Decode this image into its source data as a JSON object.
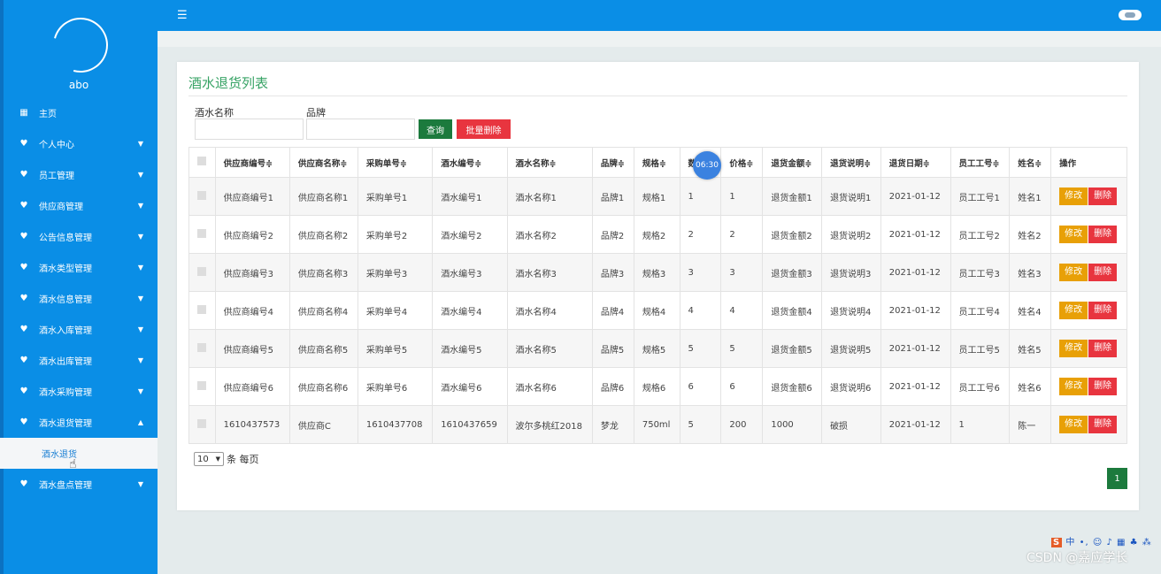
{
  "sidebar": {
    "username": "abo",
    "items": [
      {
        "label": "主页",
        "icon": "dashboard-icon",
        "expandable": false
      },
      {
        "label": "个人中心",
        "icon": "user-icon",
        "expandable": true
      },
      {
        "label": "员工管理",
        "icon": "user-icon",
        "expandable": true
      },
      {
        "label": "供应商管理",
        "icon": "user-icon",
        "expandable": true
      },
      {
        "label": "公告信息管理",
        "icon": "user-icon",
        "expandable": true
      },
      {
        "label": "酒水类型管理",
        "icon": "user-icon",
        "expandable": true
      },
      {
        "label": "酒水信息管理",
        "icon": "user-icon",
        "expandable": true
      },
      {
        "label": "酒水入库管理",
        "icon": "user-icon",
        "expandable": true
      },
      {
        "label": "酒水出库管理",
        "icon": "user-icon",
        "expandable": true
      },
      {
        "label": "酒水采购管理",
        "icon": "user-icon",
        "expandable": true
      },
      {
        "label": "酒水退货管理",
        "icon": "user-icon",
        "expandable": true,
        "expanded": true
      }
    ],
    "subitem": "酒水退货",
    "last_item": {
      "label": "酒水盘点管理",
      "icon": "user-icon",
      "expandable": true
    }
  },
  "page": {
    "title": "酒水退货列表",
    "filter_name_label": "酒水名称",
    "filter_brand_label": "品牌",
    "query_label": "查询",
    "batch_delete_label": "批量删除"
  },
  "table": {
    "headers": [
      "供应商编号≑",
      "供应商名称≑",
      "采购单号≑",
      "酒水编号≑",
      "酒水名称≑",
      "品牌≑",
      "规格≑",
      "数量≑",
      "价格≑",
      "退货金额≑",
      "退货说明≑",
      "退货日期≑",
      "员工工号≑",
      "姓名≑",
      "操作"
    ],
    "rows": [
      [
        "供应商编号1",
        "供应商名称1",
        "采购单号1",
        "酒水编号1",
        "酒水名称1",
        "品牌1",
        "规格1",
        "1",
        "1",
        "退货金额1",
        "退货说明1",
        "2021-01-12",
        "员工工号1",
        "姓名1"
      ],
      [
        "供应商编号2",
        "供应商名称2",
        "采购单号2",
        "酒水编号2",
        "酒水名称2",
        "品牌2",
        "规格2",
        "2",
        "2",
        "退货金额2",
        "退货说明2",
        "2021-01-12",
        "员工工号2",
        "姓名2"
      ],
      [
        "供应商编号3",
        "供应商名称3",
        "采购单号3",
        "酒水编号3",
        "酒水名称3",
        "品牌3",
        "规格3",
        "3",
        "3",
        "退货金额3",
        "退货说明3",
        "2021-01-12",
        "员工工号3",
        "姓名3"
      ],
      [
        "供应商编号4",
        "供应商名称4",
        "采购单号4",
        "酒水编号4",
        "酒水名称4",
        "品牌4",
        "规格4",
        "4",
        "4",
        "退货金额4",
        "退货说明4",
        "2021-01-12",
        "员工工号4",
        "姓名4"
      ],
      [
        "供应商编号5",
        "供应商名称5",
        "采购单号5",
        "酒水编号5",
        "酒水名称5",
        "品牌5",
        "规格5",
        "5",
        "5",
        "退货金额5",
        "退货说明5",
        "2021-01-12",
        "员工工号5",
        "姓名5"
      ],
      [
        "供应商编号6",
        "供应商名称6",
        "采购单号6",
        "酒水编号6",
        "酒水名称6",
        "品牌6",
        "规格6",
        "6",
        "6",
        "退货金额6",
        "退货说明6",
        "2021-01-12",
        "员工工号6",
        "姓名6"
      ],
      [
        "1610437573",
        "供应商C",
        "1610437708",
        "1610437659",
        "波尔多桃红2018",
        "梦龙",
        "750ml",
        "5",
        "200",
        "1000",
        "破损",
        "2021-01-12",
        "1",
        "陈一"
      ]
    ],
    "edit_label": "修改",
    "delete_label": "删除"
  },
  "timer_badge": "06:30",
  "pagination": {
    "page_size": "10",
    "per_page_label": "条 每页",
    "current_page": "1"
  },
  "ime_toolbar": "中 •, ☺ ♪ ▦ ♣ ⁂",
  "watermark": "CSDN @嘉应学长",
  "colors": {
    "sidebar": "#0a8ee6",
    "accent_green": "#1c7a3d",
    "danger": "#e8353f",
    "warning": "#e8a007",
    "title_green": "#37a365"
  }
}
